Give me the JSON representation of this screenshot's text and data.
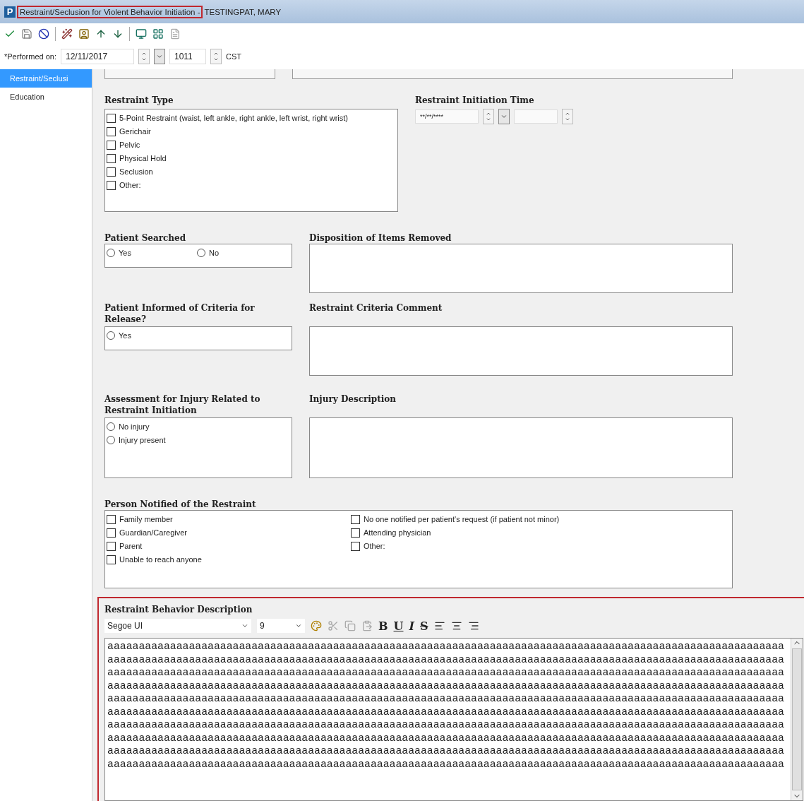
{
  "window": {
    "app_letter": "P",
    "title": "Restraint/Seclusion for Violent Behavior Initiation - ",
    "patient": "TESTINGPAT, MARY"
  },
  "performed_on": {
    "label": "*Performed on:",
    "date": "12/11/2017",
    "time": "1011",
    "timezone": "CST"
  },
  "sidebar": {
    "items": [
      {
        "label": "Restraint/Seclusi",
        "selected": true
      },
      {
        "label": "Education",
        "selected": false
      }
    ]
  },
  "restraint_type": {
    "title": "Restraint Type",
    "options": [
      {
        "label": "5-Point Restraint (waist, left ankle, right ankle, left wrist, right wrist)",
        "checked": false
      },
      {
        "label": "Gerichair",
        "checked": false
      },
      {
        "label": "Pelvic",
        "checked": false
      },
      {
        "label": "Physical Hold",
        "checked": false
      },
      {
        "label": "Seclusion",
        "checked": false
      },
      {
        "label": "Other:",
        "checked": false
      }
    ]
  },
  "initiation_time": {
    "title": "Restraint Initiation Time",
    "date_placeholder": "**/**/****"
  },
  "patient_searched": {
    "title": "Patient Searched",
    "options": [
      {
        "label": "Yes",
        "selected": false
      },
      {
        "label": "No",
        "selected": false
      }
    ]
  },
  "disposition": {
    "title": "Disposition of Items Removed"
  },
  "informed": {
    "title": "Patient Informed of Criteria for Release?",
    "options": [
      {
        "label": "Yes",
        "selected": false
      }
    ]
  },
  "criteria_comment": {
    "title": "Restraint Criteria Comment"
  },
  "injury_assessment": {
    "title": "Assessment for Injury Related to Restraint Initiation",
    "options": [
      {
        "label": "No injury",
        "selected": false
      },
      {
        "label": "Injury present",
        "selected": false
      }
    ]
  },
  "injury_description": {
    "title": "Injury Description"
  },
  "person_notified": {
    "title": "Person Notified of the Restraint",
    "columns": [
      [
        {
          "label": "Family member",
          "checked": false
        },
        {
          "label": "Guardian/Caregiver",
          "checked": false
        },
        {
          "label": "Parent",
          "checked": false
        },
        {
          "label": "Unable to reach anyone",
          "checked": false
        }
      ],
      [
        {
          "label": "No one notified per patient's request (if patient not minor)",
          "checked": false
        },
        {
          "label": "Attending physician",
          "checked": false
        },
        {
          "label": "Other:",
          "checked": false
        }
      ]
    ]
  },
  "behavior_description": {
    "title": "Restraint Behavior Description",
    "font": "Segoe UI",
    "size": "9",
    "toolbar": [
      "B",
      "U",
      "I",
      "S"
    ],
    "lines": [
      "aaaaaaaaaaaaaaaaaaaaaaaaaaaaaaaaaaaaaaaaaaaaaaaaaaaaaaaaaaaaaaaaaaaaaaaaaaaaaaaaaaaaaaaaaaaaaaaaaaaaaaaaaaaa",
      "aaaaaaaaaaaaaaaaaaaaaaaaaaaaaaaaaaaaaaaaaaaaaaaaaaaaaaaaaaaaaaaaaaaaaaaaaaaaaaaaaaaaaaaaaaaaaaaaaaaaaaaaaaaa",
      "aaaaaaaaaaaaaaaaaaaaaaaaaaaaaaaaaaaaaaaaaaaaaaaaaaaaaaaaaaaaaaaaaaaaaaaaaaaaaaaaaaaaaaaaaaaaaaaaaaaaaaaaaaaa",
      "aaaaaaaaaaaaaaaaaaaaaaaaaaaaaaaaaaaaaaaaaaaaaaaaaaaaaaaaaaaaaaaaaaaaaaaaaaaaaaaaaaaaaaaaaaaaaaaaaaaaaaaaaaaa",
      "aaaaaaaaaaaaaaaaaaaaaaaaaaaaaaaaaaaaaaaaaaaaaaaaaaaaaaaaaaaaaaaaaaaaaaaaaaaaaaaaaaaaaaaaaaaaaaaaaaaaaaaaaaaa",
      "aaaaaaaaaaaaaaaaaaaaaaaaaaaaaaaaaaaaaaaaaaaaaaaaaaaaaaaaaaaaaaaaaaaaaaaaaaaaaaaaaaaaaaaaaaaaaaaaaaaaaaaaaaaa",
      "aaaaaaaaaaaaaaaaaaaaaaaaaaaaaaaaaaaaaaaaaaaaaaaaaaaaaaaaaaaaaaaaaaaaaaaaaaaaaaaaaaaaaaaaaaaaaaaaaaaaaaaaaaaa",
      "aaaaaaaaaaaaaaaaaaaaaaaaaaaaaaaaaaaaaaaaaaaaaaaaaaaaaaaaaaaaaaaaaaaaaaaaaaaaaaaaaaaaaaaaaaaaaaaaaaaaaaaaaaaa",
      "aaaaaaaaaaaaaaaaaaaaaaaaaaaaaaaaaaaaaaaaaaaaaaaaaaaaaaaaaaaaaaaaaaaaaaaaaaaaaaaaaaaaaaaaaaaaaaaaaaaaaaaaaaaa",
      "aaaaaaaaaaaaaaaaaaaaaaaaaaaaaaaaaaaaaaaaaaaaaaaaaaaaaaaaaaaaaaaaaaaaaaaaaaaaaaaaaaaaaaaaaaaaaaaaaaaaaaaaaaaa"
    ]
  }
}
